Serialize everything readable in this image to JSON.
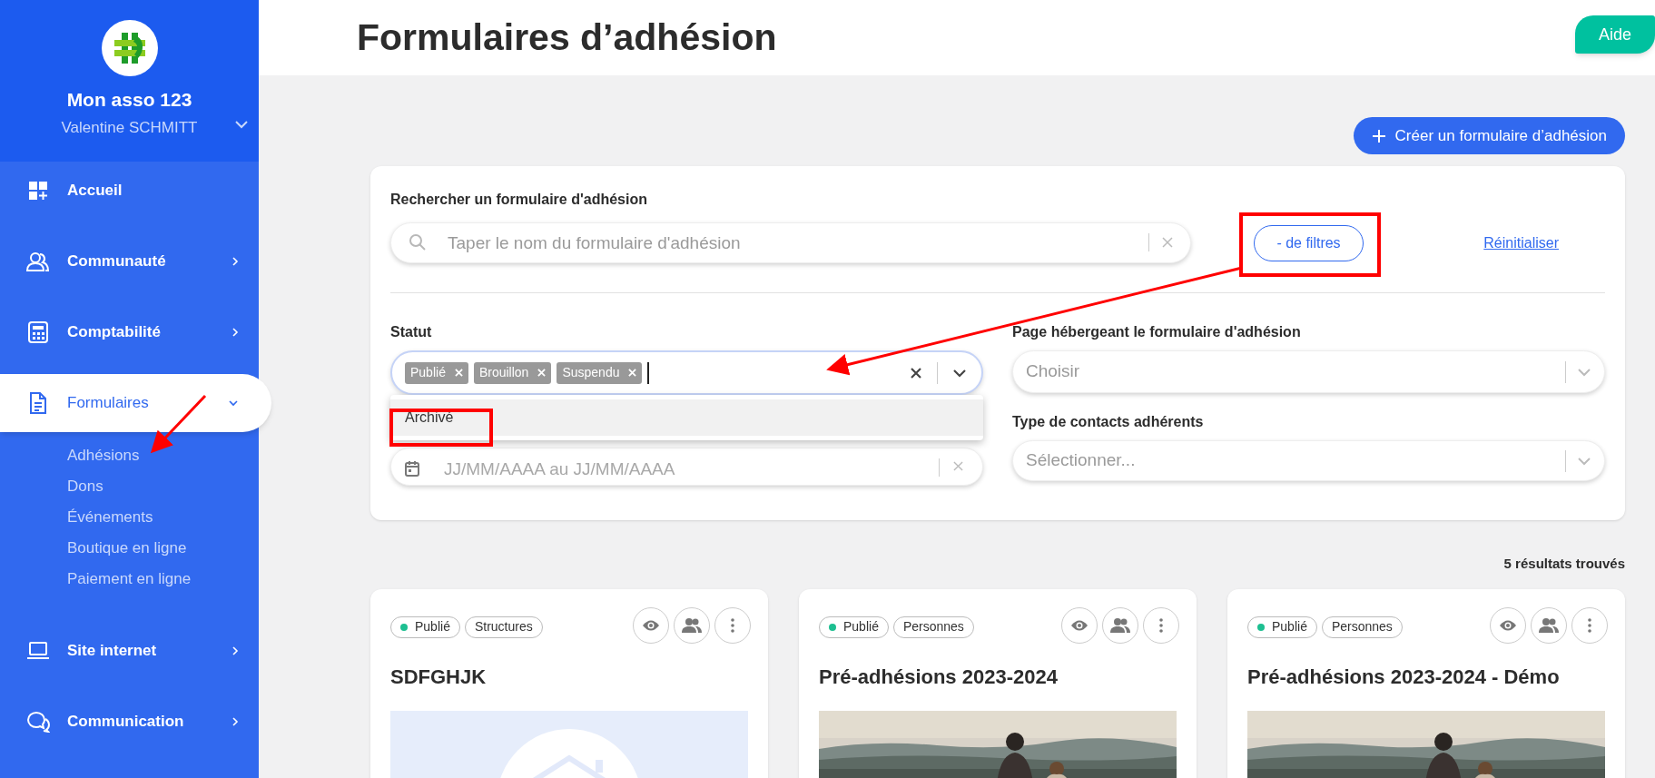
{
  "sidebar": {
    "org_name": "Mon asso 123",
    "user_name": "Valentine SCHMITT",
    "items": [
      {
        "label": "Accueil",
        "kind": "link",
        "selected": false
      },
      {
        "label": "Communauté",
        "kind": "group",
        "selected": false,
        "expanded": false
      },
      {
        "label": "Comptabilité",
        "kind": "group",
        "selected": false,
        "expanded": false
      },
      {
        "label": "Formulaires",
        "kind": "group",
        "selected": true,
        "expanded": true,
        "children": [
          {
            "label": "Adhésions"
          },
          {
            "label": "Dons"
          },
          {
            "label": "Événements"
          },
          {
            "label": "Boutique en ligne"
          },
          {
            "label": "Paiement en ligne"
          }
        ]
      },
      {
        "label": "Site internet",
        "kind": "group",
        "selected": false,
        "expanded": false
      },
      {
        "label": "Communication",
        "kind": "group",
        "selected": false,
        "expanded": false
      }
    ]
  },
  "header": {
    "title": "Formulaires d’adhésion",
    "help_button": "Aide"
  },
  "create_button": "Créer un formulaire d’adhésion",
  "filters": {
    "search_label": "Rechercher un formulaire d'adhésion",
    "search_placeholder": "Taper le nom du formulaire d'adhésion",
    "less_filters_button": "- de filtres",
    "reset_link": "Réinitialiser",
    "status": {
      "label": "Statut",
      "tags": [
        "Publié",
        "Brouillon",
        "Suspendu"
      ],
      "options": [
        "Archivé"
      ]
    },
    "date_field": {
      "placeholder": "JJ/MM/AAAA au JJ/MM/AAAA"
    },
    "page_field": {
      "label": "Page hébergeant le formulaire d'adhésion",
      "placeholder": "Choisir"
    },
    "contacts_field": {
      "label": "Type de contacts adhérents",
      "placeholder": "Sélectionner..."
    }
  },
  "results_count": "5 résultats trouvés",
  "cards": [
    {
      "status": "Publié",
      "color": "#1dbf91",
      "type": "Structures",
      "title": "SDFGHJK",
      "image": {
        "kind": "placeholder"
      }
    },
    {
      "status": "Publié",
      "color": "#1dbf91",
      "type": "Personnes",
      "title": "Pré-adhésions 2023-2024"
    },
    {
      "status": "Publié",
      "color": "#1dbf91",
      "type": "Personnes",
      "title": "Pré-adhésions 2023-2024 - Démo"
    }
  ]
}
